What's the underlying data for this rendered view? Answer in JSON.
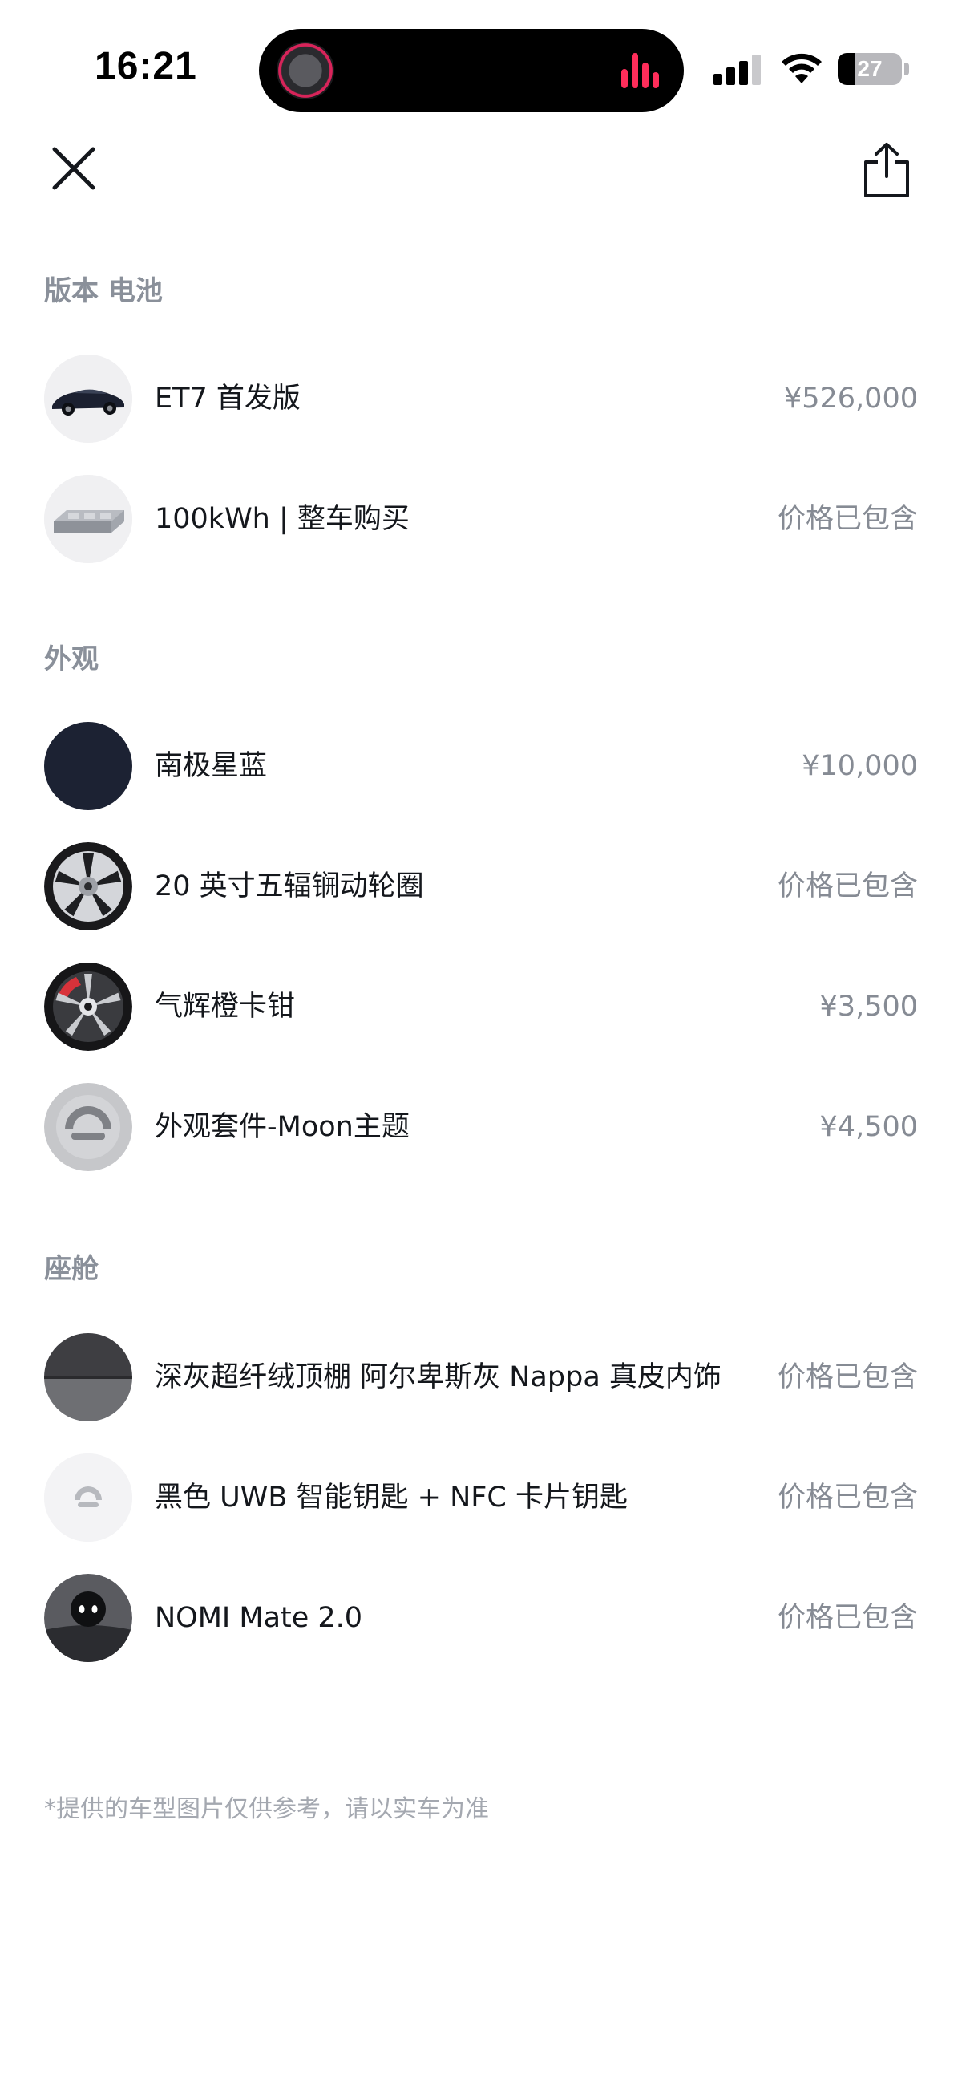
{
  "status_bar": {
    "time": "16:21",
    "battery": "27",
    "battery_level": 0.27,
    "icons": [
      "album-art-icon",
      "audio-wave-icon",
      "cellular-signal-icon",
      "wifi-icon",
      "battery-icon"
    ]
  },
  "header": {
    "close_icon": "close-icon",
    "share_icon": "share-icon"
  },
  "sections": [
    {
      "title": "版本 电池",
      "items": [
        {
          "label": "ET7 首发版",
          "price": "¥526,000",
          "thumb": "car"
        },
        {
          "label": "100kWh | 整车购买",
          "price": "价格已包含",
          "thumb": "battery"
        }
      ]
    },
    {
      "title": "外观",
      "items": [
        {
          "label": "南极星蓝",
          "price": "¥10,000",
          "thumb": "paint-blue"
        },
        {
          "label": "20 英寸五辐锎动轮圈",
          "price": "价格已包含",
          "thumb": "wheel-silver"
        },
        {
          "label": "气辉橙卡钳",
          "price": "¥3,500",
          "thumb": "wheel-caliper"
        },
        {
          "label": "外观套件-Moon主题",
          "price": "¥4,500",
          "thumb": "logo-moon"
        }
      ]
    },
    {
      "title": "座舱",
      "items": [
        {
          "label": "深灰超纤绒顶棚 阿尔卑斯灰 Nappa 真皮内饰",
          "price": "价格已包含",
          "thumb": "interior"
        },
        {
          "label": "黑色 UWB 智能钥匙 + NFC 卡片钥匙",
          "price": "价格已包含",
          "thumb": "key"
        },
        {
          "label": "NOMI Mate 2.0",
          "price": "价格已包含",
          "thumb": "nomi"
        }
      ]
    }
  ],
  "disclaimer": "*提供的车型图片仅供参考，请以实车为准",
  "colors": {
    "text_primary": "#14171c",
    "text_secondary": "#868b94",
    "section_title": "#8a909a",
    "background": "#ffffff",
    "paint_blue": "#1c2233",
    "accent_red": "#ff2d5a"
  }
}
